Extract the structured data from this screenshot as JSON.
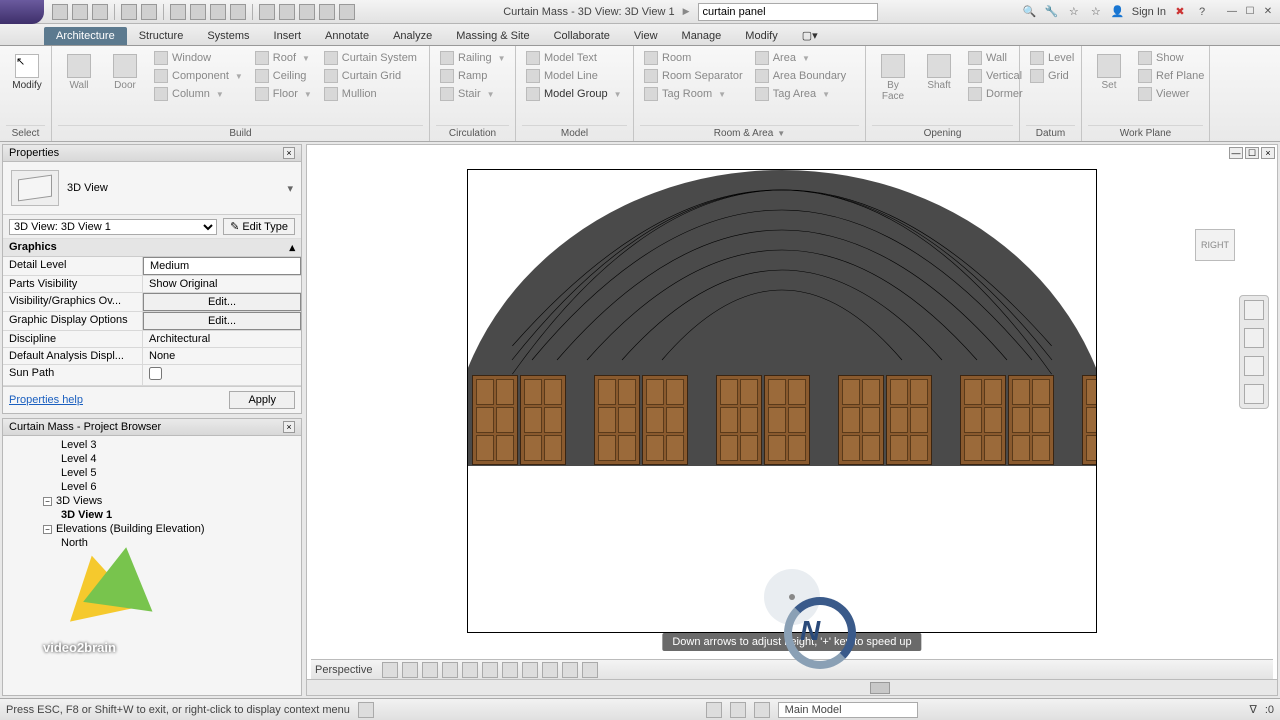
{
  "titlebar": {
    "doc_title": "Curtain Mass - 3D View: 3D View 1",
    "search_value": "curtain panel",
    "signin": "Sign In"
  },
  "ribbon_tabs": [
    "Architecture",
    "Structure",
    "Systems",
    "Insert",
    "Annotate",
    "Analyze",
    "Massing & Site",
    "Collaborate",
    "View",
    "Manage",
    "Modify"
  ],
  "active_tab": "Architecture",
  "ribbon": {
    "select": {
      "modify": "Modify",
      "label": "Select"
    },
    "build": {
      "label": "Build",
      "wall": "Wall",
      "door": "Door",
      "window": "Window",
      "component": "Component",
      "column": "Column",
      "roof": "Roof",
      "ceiling": "Ceiling",
      "floor": "Floor",
      "curtain_system": "Curtain System",
      "curtain_grid": "Curtain Grid",
      "mullion": "Mullion"
    },
    "circulation": {
      "label": "Circulation",
      "railing": "Railing",
      "ramp": "Ramp",
      "stair": "Stair"
    },
    "model": {
      "label": "Model",
      "text": "Model Text",
      "line": "Model Line",
      "group": "Model Group"
    },
    "room_area": {
      "label": "Room & Area",
      "room": "Room",
      "room_sep": "Room Separator",
      "tag_room": "Tag Room",
      "area": "Area",
      "area_boundary": "Area Boundary",
      "tag_area": "Tag Area"
    },
    "opening": {
      "label": "Opening",
      "by_face": "By Face",
      "shaft": "Shaft",
      "wall": "Wall",
      "vertical": "Vertical",
      "dormer": "Dormer"
    },
    "datum": {
      "label": "Datum",
      "level": "Level",
      "grid": "Grid"
    },
    "workplane": {
      "label": "Work Plane",
      "set": "Set",
      "show": "Show",
      "ref": "Ref Plane",
      "viewer": "Viewer"
    }
  },
  "properties": {
    "header": "Properties",
    "type_name": "3D View",
    "instance": "3D View: 3D View 1",
    "edit_type": "Edit Type",
    "group": "Graphics",
    "rows": {
      "detail_level": {
        "k": "Detail Level",
        "v": "Medium"
      },
      "parts": {
        "k": "Parts Visibility",
        "v": "Show Original"
      },
      "vg": {
        "k": "Visibility/Graphics Ov...",
        "v": "Edit..."
      },
      "gdo": {
        "k": "Graphic Display Options",
        "v": "Edit..."
      },
      "discipline": {
        "k": "Discipline",
        "v": "Architectural"
      },
      "analysis": {
        "k": "Default Analysis Displ...",
        "v": "None"
      },
      "sunpath": {
        "k": "Sun Path",
        "v": ""
      }
    },
    "help": "Properties help",
    "apply": "Apply"
  },
  "browser": {
    "header": "Curtain Mass - Project Browser",
    "levels": [
      "Level 3",
      "Level 4",
      "Level 5",
      "Level 6"
    ],
    "views3d": "3D Views",
    "view3d_item": "3D View 1",
    "elev_group": "Elevations (Building Elevation)",
    "elev_item": "North"
  },
  "viewport": {
    "cube_face": "RIGHT",
    "tooltip": "Down arrows to adjust height, '+' key to speed up",
    "mode": "Perspective"
  },
  "status": {
    "hint": "Press ESC, F8 or Shift+W to exit, or right-click to display context menu",
    "workset": "Main Model",
    "filter": ":0"
  },
  "watermark": "video2brain"
}
